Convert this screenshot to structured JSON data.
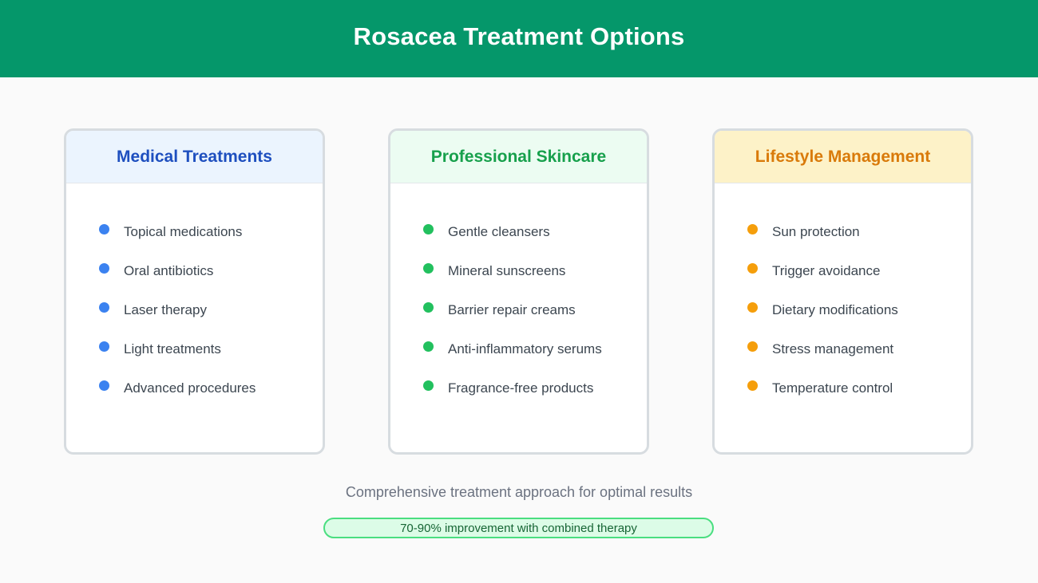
{
  "title": "Rosacea Treatment Options",
  "cards": [
    {
      "heading": "Medical Treatments",
      "items": [
        "Topical medications",
        "Oral antibiotics",
        "Laser therapy",
        "Light treatments",
        "Advanced procedures"
      ]
    },
    {
      "heading": "Professional Skincare",
      "items": [
        "Gentle cleansers",
        "Mineral sunscreens",
        "Barrier repair creams",
        "Anti-inflammatory serums",
        "Fragrance-free products"
      ]
    },
    {
      "heading": "Lifestyle Management",
      "items": [
        "Sun protection",
        "Trigger avoidance",
        "Dietary modifications",
        "Stress management",
        "Temperature control"
      ]
    }
  ],
  "footer": {
    "text": "Comprehensive treatment approach for optimal results",
    "badge": "70-90% improvement with combined therapy"
  },
  "colors": {
    "header": "#05976a",
    "medical": "#3b82f0",
    "skincare": "#22c05e",
    "lifestyle": "#f59e0b"
  }
}
